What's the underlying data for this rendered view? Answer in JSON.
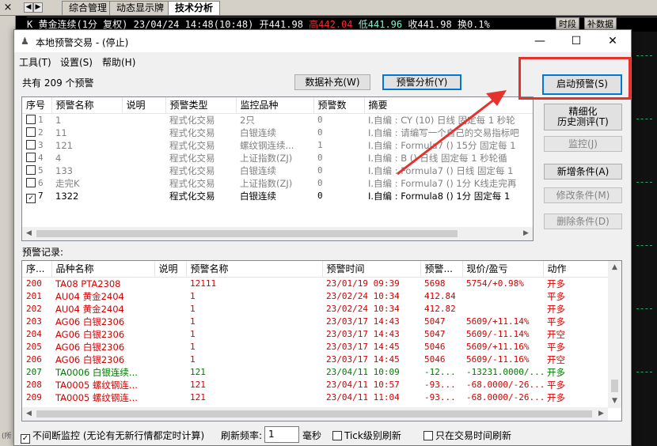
{
  "background": {
    "close_glyph": "×",
    "tabs": [
      "综合管理",
      "动态显示牌",
      "技术分析"
    ],
    "ticker": {
      "prefix": "K",
      "name": "黄金连续(1分 复权)",
      "date": "23/04/24",
      "time": "14:48(10:48)",
      "open": "开441.98",
      "high": "高442.04",
      "low": "低441.96",
      "close": "收441.98",
      "turnover": "换0.1%"
    },
    "chips": [
      "时段",
      "补数据"
    ],
    "left_bottom_text": "(所"
  },
  "dialog": {
    "title": "本地预警交易 - (停止)",
    "controls": {
      "minimize": "—",
      "maximize": "☐",
      "close": "✕"
    },
    "menu": [
      "工具(T)",
      "设置(S)",
      "帮助(H)"
    ],
    "summary": "共有 209 个预警",
    "buttons": {
      "data_fill": "数据补充(W)",
      "alert_analysis": "预警分析(Y)",
      "start_alert": "启动预警(S)",
      "refine_line1": "精细化",
      "refine_line2": "历史测评(T)",
      "monitor": "监控(J)",
      "add_condition": "新增条件(A)",
      "modify_condition": "修改条件(M)",
      "delete_condition": "删除条件(D)"
    },
    "alert_table": {
      "columns": [
        "序号",
        "预警名称",
        "说明",
        "预警类型",
        "监控品种",
        "预警数",
        "摘要"
      ],
      "rows": [
        {
          "checked": false,
          "no": "1",
          "name": "1",
          "desc": "",
          "type": "程式化交易",
          "target": "2只",
          "count": "0",
          "summary": "I.自编 : CY (10) 日线 固定每 1 秒轮"
        },
        {
          "checked": false,
          "no": "2",
          "name": "11",
          "desc": "",
          "type": "程式化交易",
          "target": "白银连续",
          "count": "0",
          "summary": "I.自编 : 请编写一个自己的交易指标吧"
        },
        {
          "checked": false,
          "no": "3",
          "name": "121",
          "desc": "",
          "type": "程式化交易",
          "target": "螺纹钢连续...",
          "count": "1",
          "summary": "I.自编 : Formula7 () 15分 固定每 1"
        },
        {
          "checked": false,
          "no": "4",
          "name": "4",
          "desc": "",
          "type": "程式化交易",
          "target": "上证指数(ZJ)",
          "count": "0",
          "summary": "I.自编 : B () 日线 固定每 1 秒轮循"
        },
        {
          "checked": false,
          "no": "5",
          "name": "133",
          "desc": "",
          "type": "程式化交易",
          "target": "白银连续",
          "count": "0",
          "summary": "I.自编 : Formula7 () 日线 固定每 1"
        },
        {
          "checked": false,
          "no": "6",
          "name": "走完K",
          "desc": "",
          "type": "程式化交易",
          "target": "上证指数(ZJ)",
          "count": "0",
          "summary": "I.自编 : Formula7 () 1分 K线走完再"
        },
        {
          "checked": true,
          "no": "7",
          "name": "1322",
          "desc": "",
          "type": "程式化交易",
          "target": "白银连续",
          "count": "0",
          "summary": "I.自编 : Formula8 () 1分 固定每 1"
        }
      ]
    },
    "records_label": "预警记录:",
    "records_table": {
      "columns": [
        "序...",
        "品种名称",
        "说明",
        "预警名称",
        "预警时间",
        "预警...",
        "现价/盈亏",
        "动作"
      ],
      "rows": [
        {
          "color": "red",
          "no": "200",
          "name": "TA08 PTA2308",
          "desc": "",
          "alert": "12111",
          "time": "23/01/19 09:39",
          "price": "5698",
          "pnl": "5754/+0.98%",
          "action": "开多"
        },
        {
          "color": "red",
          "no": "201",
          "name": "AU04 黄金2404",
          "desc": "",
          "alert": "1",
          "time": "23/02/24 10:34",
          "price": "412.84",
          "pnl": "",
          "action": "平多"
        },
        {
          "color": "red",
          "no": "202",
          "name": "AU04 黄金2404",
          "desc": "",
          "alert": "1",
          "time": "23/02/24 10:34",
          "price": "412.82",
          "pnl": "",
          "action": "开多"
        },
        {
          "color": "red",
          "no": "203",
          "name": "AG06 白银2306",
          "desc": "",
          "alert": "1",
          "time": "23/03/17 14:43",
          "price": "5047",
          "pnl": "5609/+11.14%",
          "action": "平多"
        },
        {
          "color": "red",
          "no": "204",
          "name": "AG06 白银2306",
          "desc": "",
          "alert": "1",
          "time": "23/03/17 14:43",
          "price": "5047",
          "pnl": "5609/-11.14%",
          "action": "开空"
        },
        {
          "color": "red",
          "no": "205",
          "name": "AG06 白银2306",
          "desc": "",
          "alert": "1",
          "time": "23/03/17 14:45",
          "price": "5046",
          "pnl": "5609/+11.16%",
          "action": "平多"
        },
        {
          "color": "red",
          "no": "206",
          "name": "AG06 白银2306",
          "desc": "",
          "alert": "1",
          "time": "23/03/17 14:45",
          "price": "5046",
          "pnl": "5609/-11.16%",
          "action": "开空"
        },
        {
          "color": "green",
          "no": "207",
          "name": "TA0006 白银连续...",
          "desc": "",
          "alert": "121",
          "time": "23/04/11 10:09",
          "price": "-12...",
          "pnl": "-13231.0000/...",
          "action": "开多"
        },
        {
          "color": "red",
          "no": "208",
          "name": "TA0005 螺纹钢连...",
          "desc": "",
          "alert": "121",
          "time": "23/04/11 10:57",
          "price": "-93...",
          "pnl": "-68.0000/-26...",
          "action": "平多"
        },
        {
          "color": "red",
          "no": "209",
          "name": "TA0005 螺纹钢连...",
          "desc": "",
          "alert": "121",
          "time": "23/04/11 11:04",
          "price": "-93...",
          "pnl": "-68.0000/-26...",
          "action": "开多"
        }
      ]
    },
    "footer": {
      "continuous_monitor": "不间断监控 (无论有无新行情都定时计算)",
      "continuous_monitor_checked": true,
      "refresh_label": "刷新频率:",
      "refresh_value": "1",
      "refresh_unit": "毫秒",
      "tick_refresh": "Tick级别刷新",
      "tick_refresh_checked": false,
      "trading_time_only": "只在交易时间刷新",
      "trading_time_only_checked": false
    }
  },
  "annotation": {
    "color": "#e5322d"
  }
}
